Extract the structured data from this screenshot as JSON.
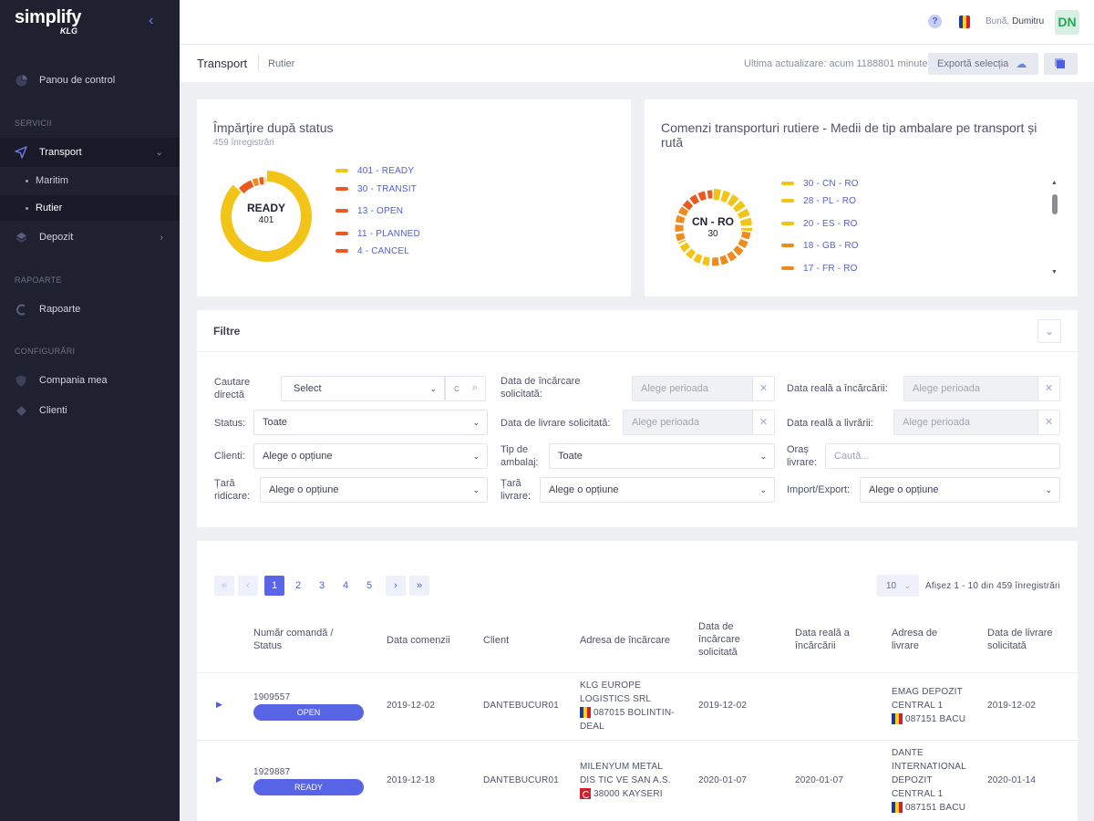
{
  "brand": {
    "name": "simplify",
    "sub": "KLG"
  },
  "sidebar": {
    "items": [
      {
        "label": "Panou de control"
      }
    ],
    "sections": [
      "SERVICII",
      "RAPOARTE",
      "CONFIGURĂRI"
    ],
    "transport": "Transport",
    "maritim": "Maritim",
    "rutier": "Rutier",
    "depozit": "Depozit",
    "rapoarte": "Rapoarte",
    "compania": "Compania mea",
    "clienti": "Clienti"
  },
  "header": {
    "help": "?",
    "greeting": "Bună,",
    "user": "Dumitru",
    "initials": "DN"
  },
  "page": {
    "title": "Transport",
    "crumb": "Rutier",
    "updated": "Ultima actualizare: acum 1188801 minute",
    "export": "Exportă selecția"
  },
  "status_card": {
    "title": "Împărțire după status",
    "count": "459 înregistrări",
    "center_label": "READY",
    "center_value": "401",
    "legend": [
      "401 - READY",
      "30 - TRANSIT",
      "13 - OPEN",
      "11 - PLANNED",
      "4 - CANCEL"
    ]
  },
  "route_card": {
    "title": "Comenzi transporturi rutiere - Medii de tip ambalare pe transport și rută",
    "center_label": "CN - RO",
    "center_value": "30",
    "legend": [
      "30 - CN - RO",
      "28 - PL - RO",
      "20 - ES - RO",
      "18 - GB - RO",
      "17 - FR - RO"
    ]
  },
  "colors": {
    "accent": "#5966ea",
    "yellow": "#f2c418",
    "orange": "#f08a1c",
    "red": "#ea5a20",
    "sidebar": "#1f2131"
  },
  "chart_data": [
    {
      "type": "pie",
      "title": "Împărțire după status",
      "categories": [
        "READY",
        "TRANSIT",
        "OPEN",
        "PLANNED",
        "CANCEL"
      ],
      "values": [
        401,
        30,
        13,
        11,
        4
      ]
    },
    {
      "type": "pie",
      "title": "Comenzi transporturi rutiere - Medii de tip ambalare pe transport și rută",
      "categories": [
        "CN - RO",
        "PL - RO",
        "ES - RO",
        "GB - RO",
        "FR - RO"
      ],
      "values": [
        30,
        28,
        20,
        18,
        17
      ]
    }
  ],
  "filters": {
    "title": "Filtre",
    "cautare": "Cautare directă",
    "select": "Select",
    "data_inc_sol": "Data de încărcare solicitată:",
    "data_inc_real": "Data reală a încărcării:",
    "status": "Status:",
    "toate": "Toate",
    "data_liv_sol": "Data de livrare solicitată:",
    "data_liv_real": "Data reală a livrării:",
    "clienti": "Clienti:",
    "optiune": "Alege o opțiune",
    "tip_ambalaj": "Tip de ambalaj:",
    "oras": "Oraș livrare:",
    "cauta": "Caută...",
    "tara_ridicare": "Țară ridicare:",
    "tara_livrare": "Țară livrare:",
    "import_export": "Import/Export:",
    "perioada": "Alege perioada"
  },
  "table": {
    "pages": [
      "1",
      "2",
      "3",
      "4",
      "5"
    ],
    "first": "«",
    "prev": "‹",
    "next": "›",
    "last": "»",
    "page_size": "10",
    "showing": "Afișez 1 - 10 din 459 înregistrări",
    "columns": [
      "Număr comandă / Status",
      "Data comenzii",
      "Client",
      "Adresa de încărcare",
      "Data de încărcare solicitată",
      "Data reală a încărcării",
      "Adresa de livrare",
      "Data de livrare solicitată"
    ],
    "rows": [
      {
        "order": "1909557",
        "status": "OPEN",
        "date": "2019-12-02",
        "client": "DANTEBUCUR01",
        "load_addr": "KLG EUROPE LOGISTICS SRL",
        "load_city": "087015 BOLINTIN-DEAL",
        "load_req": "2019-12-02",
        "load_real": "",
        "del_addr": "EMAG DEPOZIT CENTRAL 1",
        "del_city": "087151 BACU",
        "del_req": "2019-12-02"
      },
      {
        "order": "1929887",
        "status": "READY",
        "date": "2019-12-18",
        "client": "DANTEBUCUR01",
        "load_addr": "MILENYUM METAL DIS TIC VE SAN A.S.",
        "load_city": "38000 KAYSERI",
        "load_req": "2020-01-07",
        "load_real": "2020-01-07",
        "del_addr": "DANTE INTERNATIONAL DEPOZIT CENTRAL 1",
        "del_city": "087151 BACU",
        "del_req": "2020-01-14"
      }
    ]
  }
}
